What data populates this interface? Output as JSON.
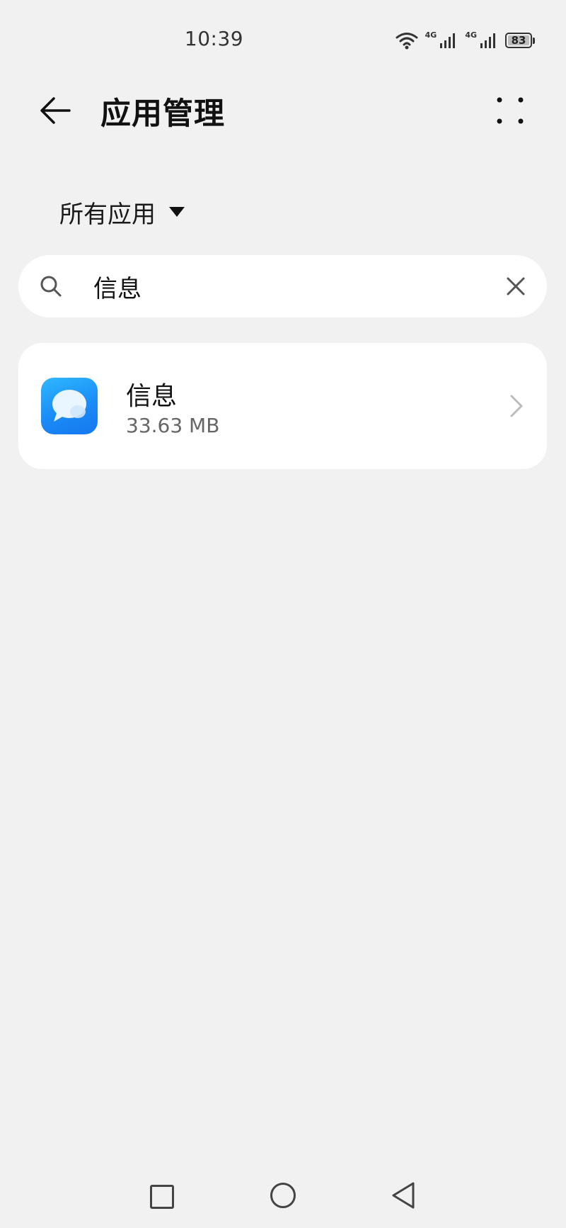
{
  "status_bar": {
    "time": "10:39",
    "network_1": "4G",
    "network_2": "4G",
    "battery_level": "83"
  },
  "header": {
    "title": "应用管理",
    "back_icon": "arrow-left-icon",
    "more_icon": "more-dots-icon"
  },
  "filter": {
    "label": "所有应用",
    "icon": "dropdown-triangle-icon"
  },
  "search": {
    "value": "信息",
    "icon": "search-icon",
    "clear_icon": "close-icon"
  },
  "apps": [
    {
      "name": "信息",
      "size": "33.63 MB",
      "icon": "messages-app-icon"
    }
  ],
  "nav": {
    "recents_icon": "square-icon",
    "home_icon": "circle-icon",
    "back_icon": "triangle-back-icon"
  },
  "colors": {
    "background": "#f1f1f1",
    "card": "#ffffff",
    "app_icon_blue": "#1a8cf7"
  }
}
